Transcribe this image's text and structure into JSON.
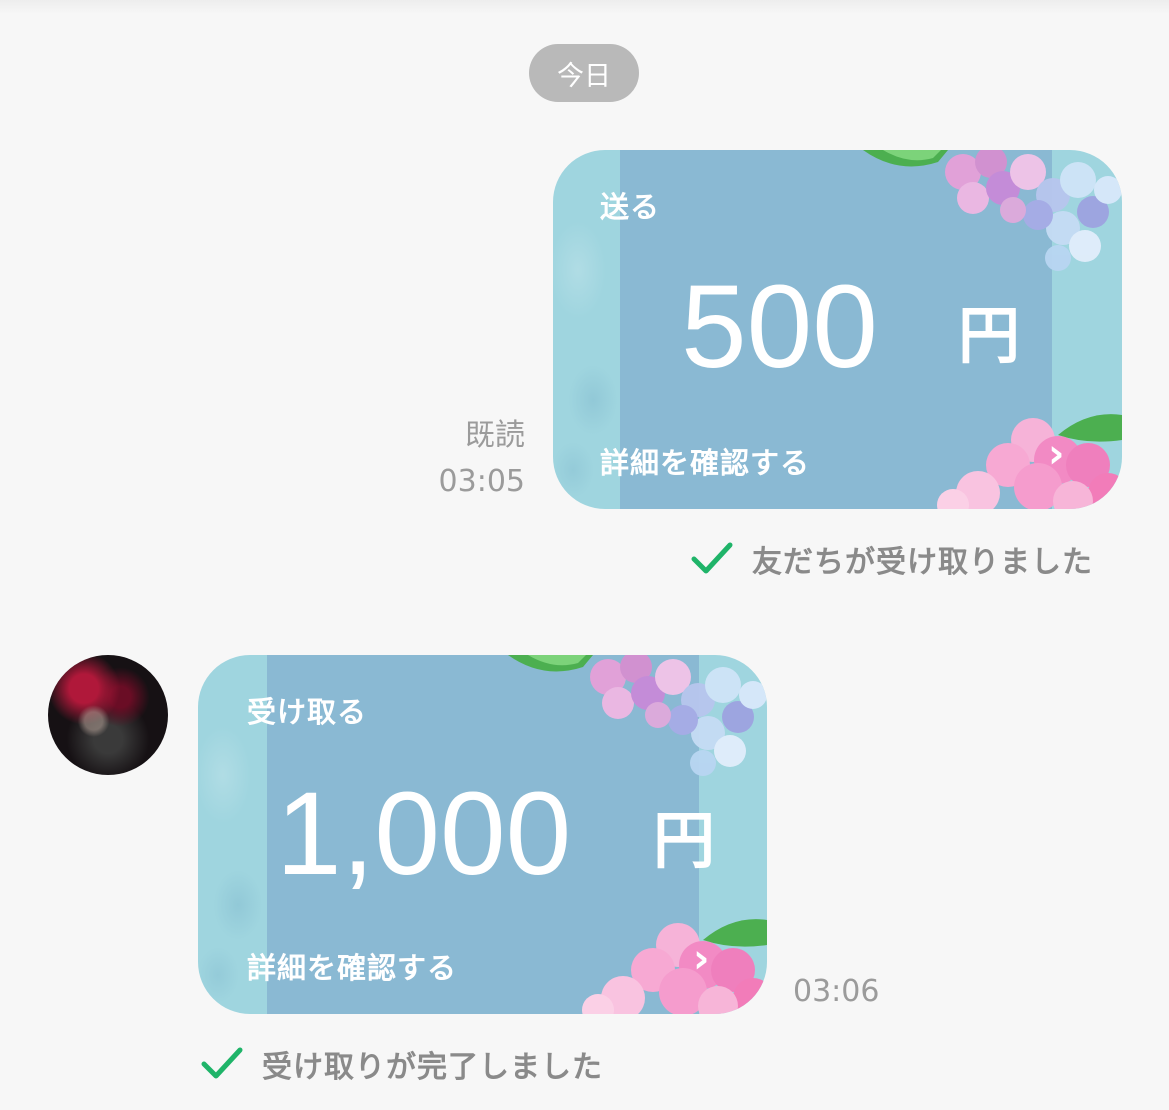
{
  "date_divider": "今日",
  "messages": [
    {
      "direction": "sent",
      "card": {
        "kind_label": "送る",
        "amount": "500",
        "currency": "円",
        "details_label": "詳細を確認する",
        "chevron": "›"
      },
      "read_label": "既読",
      "time": "03:05",
      "status_text": "友だちが受け取りました"
    },
    {
      "direction": "received",
      "card": {
        "kind_label": "受け取る",
        "amount": "1,000",
        "currency": "円",
        "details_label": "詳細を確認する",
        "chevron": "›"
      },
      "time": "03:06",
      "status_text": "受け取りが完了しました"
    }
  ],
  "colors": {
    "background": "#f7f7f7",
    "card_outer": "#9fd5df",
    "card_panel": "#8ab9d3",
    "check_green": "#1fb469",
    "meta_gray": "#9b9b9b"
  },
  "icons": {
    "check": "check-icon",
    "chevron": "chevron-right-icon",
    "decoration": "hydrangea-flowers"
  }
}
